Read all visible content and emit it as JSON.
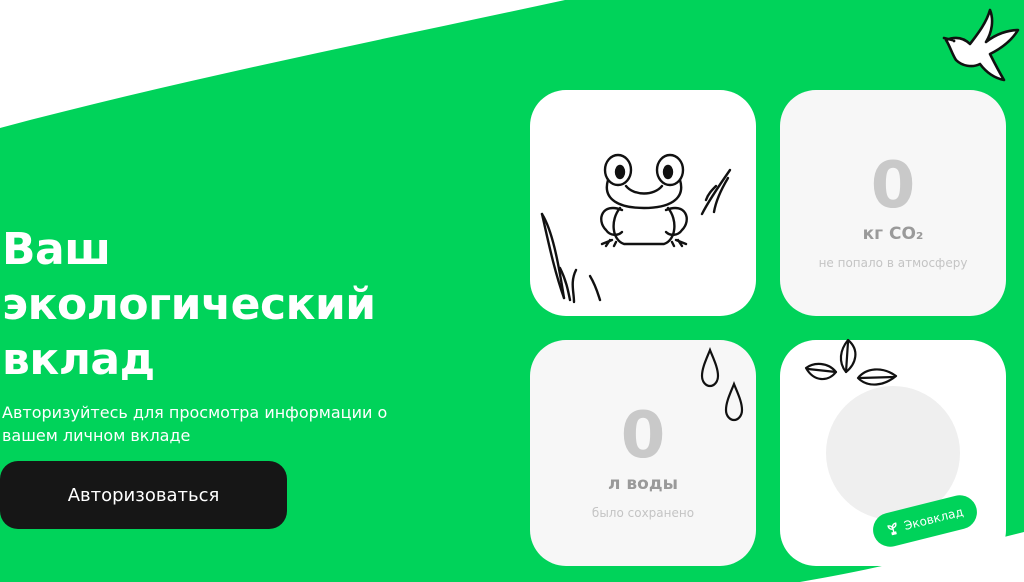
{
  "colors": {
    "brand_green": "#00D35A",
    "button_dark": "#161616",
    "card_bg": "#F7F7F7",
    "stat_number": "#C9C9C9"
  },
  "hero": {
    "title_line1": "Ваш",
    "title_line2": "экологический",
    "title_line3": "вклад",
    "subtitle": "Авторизуйтесь для просмотра информации о вашем личном вкладе",
    "button_label": "Авторизоваться"
  },
  "cards": {
    "frog": {
      "icon": "frog-grass-illustration"
    },
    "co2": {
      "value": "0",
      "unit": "кг CO₂",
      "note": "не попало в атмосферу"
    },
    "water": {
      "value": "0",
      "unit": "л воды",
      "note": "было сохранено"
    },
    "eco": {
      "badge_label": "Эковклад",
      "icon": "leaves-illustration"
    }
  },
  "decor": {
    "icon": "dove-icon"
  }
}
